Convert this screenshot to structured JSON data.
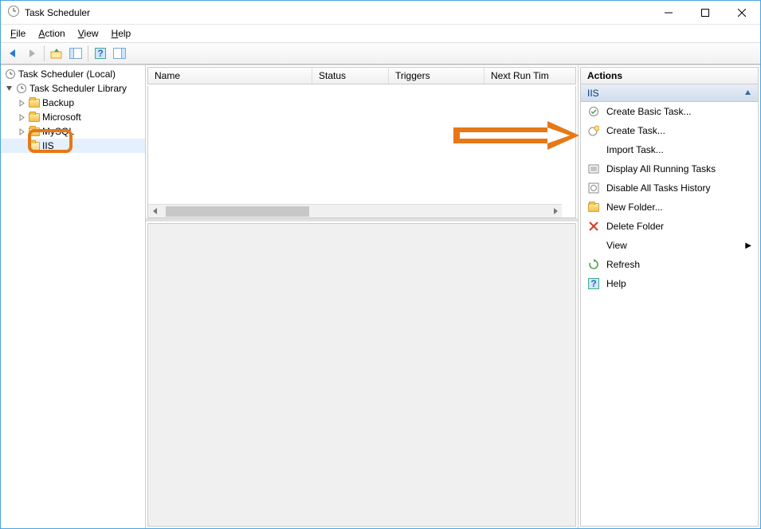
{
  "window": {
    "title": "Task Scheduler"
  },
  "menu": {
    "file": "File",
    "action": "Action",
    "view": "View",
    "help": "Help"
  },
  "tree": {
    "root": "Task Scheduler (Local)",
    "library": "Task Scheduler Library",
    "items": [
      {
        "label": "Backup"
      },
      {
        "label": "Microsoft"
      },
      {
        "label": "MySQL"
      },
      {
        "label": "IIS"
      }
    ]
  },
  "list": {
    "columns": {
      "name": "Name",
      "status": "Status",
      "triggers": "Triggers",
      "next": "Next Run Tim"
    }
  },
  "actions": {
    "title": "Actions",
    "group": "IIS",
    "items": [
      {
        "label": "Create Basic Task..."
      },
      {
        "label": "Create Task..."
      },
      {
        "label": "Import Task..."
      },
      {
        "label": "Display All Running Tasks"
      },
      {
        "label": "Disable All Tasks History"
      },
      {
        "label": "New Folder..."
      },
      {
        "label": "Delete Folder"
      },
      {
        "label": "View",
        "submenu": true
      },
      {
        "label": "Refresh"
      },
      {
        "label": "Help"
      }
    ]
  }
}
